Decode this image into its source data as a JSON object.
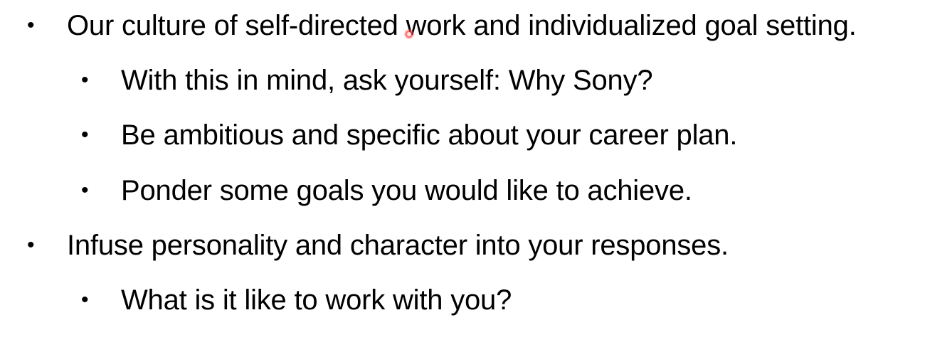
{
  "bullets": [
    {
      "glyph": "•",
      "text": "Our culture of self-directed work and individualized goal setting."
    },
    {
      "glyph": "•",
      "text": "With this in mind, ask yourself: Why Sony?"
    },
    {
      "glyph": "•",
      "text": "Be ambitious and specific about your career plan."
    },
    {
      "glyph": "•",
      "text": "Ponder some goals you would like to achieve."
    },
    {
      "glyph": "•",
      "text": "Infuse personality and character into your responses."
    },
    {
      "glyph": "•",
      "text": "What is it like to work with you?"
    }
  ],
  "pointer": {
    "icon": "laser-pointer-icon",
    "color": "#ff2020"
  }
}
